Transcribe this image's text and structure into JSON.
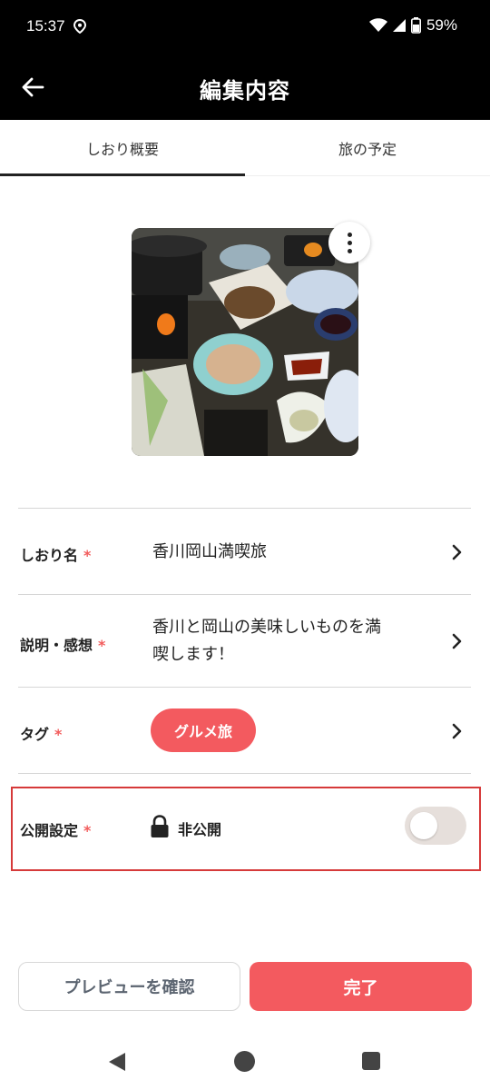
{
  "status_bar": {
    "time": "15:37",
    "battery": "59%",
    "icons": [
      "location-icon",
      "wifi-icon",
      "signal-icon",
      "battery-icon"
    ]
  },
  "header": {
    "title": "編集内容",
    "back_icon": "arrow-left-icon"
  },
  "tabs": [
    {
      "label": "しおり概要",
      "selected": true
    },
    {
      "label": "旅の予定",
      "selected": false
    }
  ],
  "photo": {
    "menu_icon": "more-vertical-icon"
  },
  "form": {
    "name": {
      "label": "しおり名",
      "required": "*",
      "value": "香川岡山満喫旅"
    },
    "description": {
      "label": "説明・感想",
      "required": "*",
      "value_line1": "香川と岡山の美味しいものを満",
      "value_line2": "喫します！"
    },
    "tag": {
      "label": "タグ",
      "required": "*",
      "value": "グルメ旅"
    },
    "visibility": {
      "label": "公開設定",
      "required": "*",
      "value": "非公開",
      "toggle_on": false
    }
  },
  "buttons": {
    "preview": "プレビューを確認",
    "done": "完了"
  },
  "colors": {
    "accent": "#f35a5f",
    "header_bg": "#000000",
    "highlight_border": "#d63a3a"
  }
}
